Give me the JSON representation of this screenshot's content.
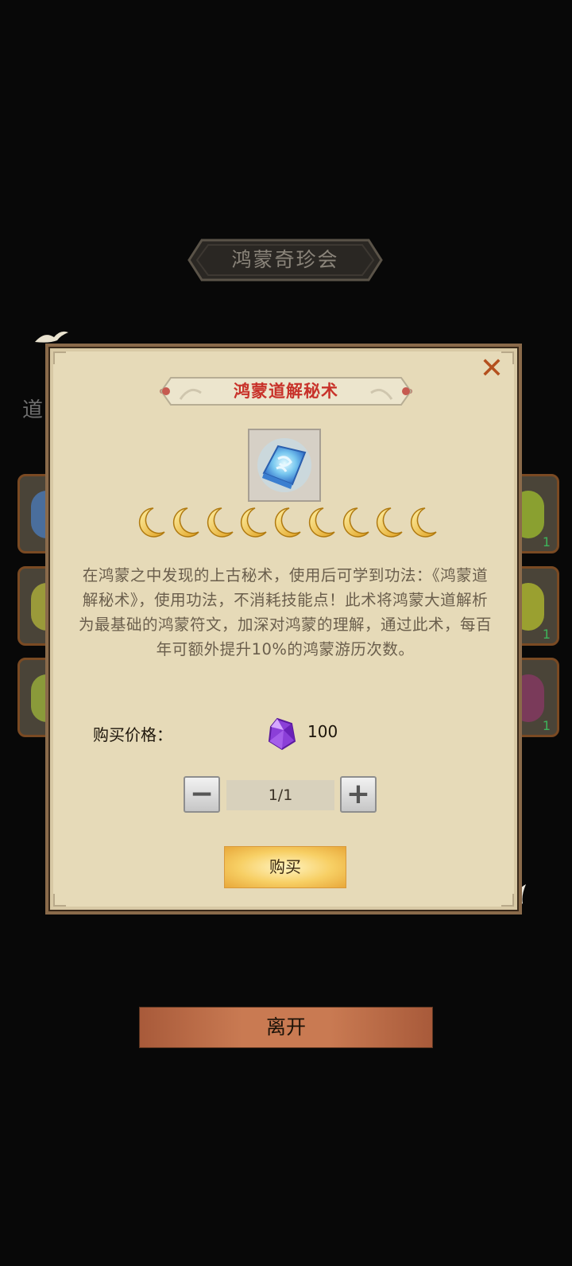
{
  "shop": {
    "title": "鸿蒙奇珍会",
    "side_label": "道",
    "slot_counts": [
      "1",
      "1",
      "1"
    ],
    "leave_label": "离开"
  },
  "dialog": {
    "title": "鸿蒙道解秘术",
    "close_icon": "close-icon",
    "item_icon": "skill-book-icon",
    "star_count": 9,
    "description": "在鸿蒙之中发现的上古秘术，使用后可学到功法：《鸿蒙道解秘术》，使用功法，不消耗技能点！此术将鸿蒙大道解析为最基础的鸿蒙符文，加深对鸿蒙的理解，通过此术，每百年可额外提升10%的鸿蒙游历次数。",
    "price_label": "购买价格：",
    "price_currency_icon": "purple-gem-icon",
    "price_value": "100",
    "quantity": "1/1",
    "buy_label": "购买"
  },
  "colors": {
    "dialog_bg": "#e6dab8",
    "title_red": "#c8322a",
    "close_orange": "#b4501e"
  }
}
